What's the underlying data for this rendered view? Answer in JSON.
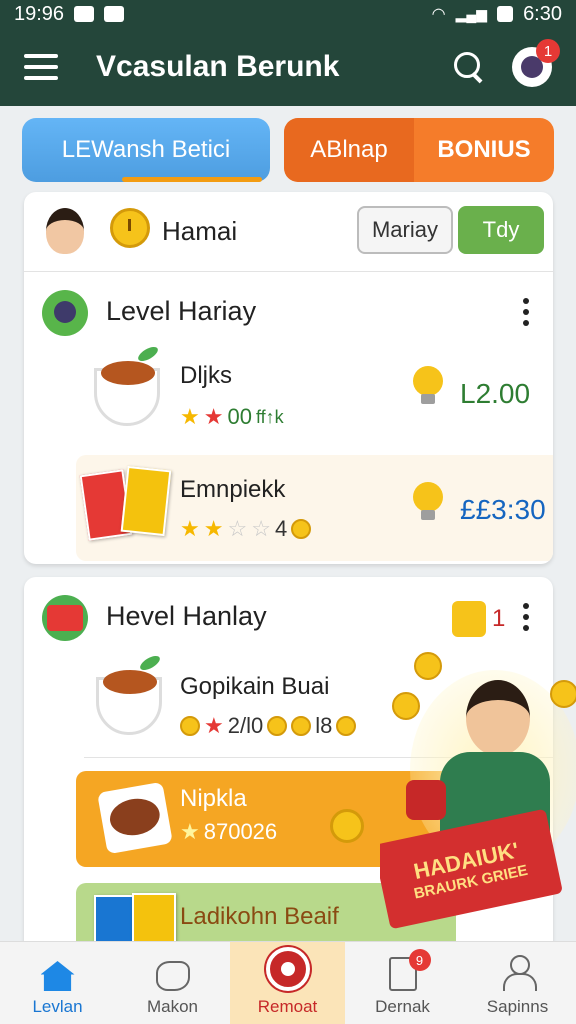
{
  "status_bar": {
    "time": "19:96",
    "right_time": "6:30"
  },
  "app_bar": {
    "title": "Vcasulan Berunk",
    "notification_count": "1"
  },
  "tabs": {
    "left": "LEWansh Betici",
    "right_a": "ABlnap",
    "right_b": "BONIUS"
  },
  "card1": {
    "user_name": "Hamai",
    "btn_outline": "Mariay",
    "btn_green": "Tdy",
    "level_title": "Level Hariay",
    "items": [
      {
        "name": "Dljks",
        "meta": "00",
        "meta2": "ff↑k",
        "price": "L2.00"
      },
      {
        "name": "Emnpiekk",
        "meta": "4",
        "price": "££3:30"
      }
    ]
  },
  "card2": {
    "level_title": "Hevel Hanlay",
    "gift_count": "1",
    "items": [
      {
        "name": "Gopikain Buai",
        "meta_a": "2/l0",
        "meta_b": "l8"
      },
      {
        "name": "Nipkla",
        "meta": "870026"
      },
      {
        "name": "Ladikohn Beaif"
      }
    ]
  },
  "promo": {
    "line1": "HADAIUK'",
    "line2": "BRAURK GRIEE"
  },
  "bottom_nav": [
    {
      "label": "Levlan",
      "icon": "home-icon"
    },
    {
      "label": "Makon",
      "icon": "map-icon"
    },
    {
      "label": "Remoat",
      "icon": "target-icon"
    },
    {
      "label": "Dernak",
      "icon": "document-icon",
      "badge": "9"
    },
    {
      "label": "Sapinns",
      "icon": "person-icon"
    }
  ],
  "colors": {
    "appbar": "#24463a",
    "tab_blue": "#64b5f6",
    "tab_orange": "#f57c2a",
    "green_button": "#6ab04c",
    "price_green": "#2e7d32",
    "price_blue": "#1565c0"
  }
}
